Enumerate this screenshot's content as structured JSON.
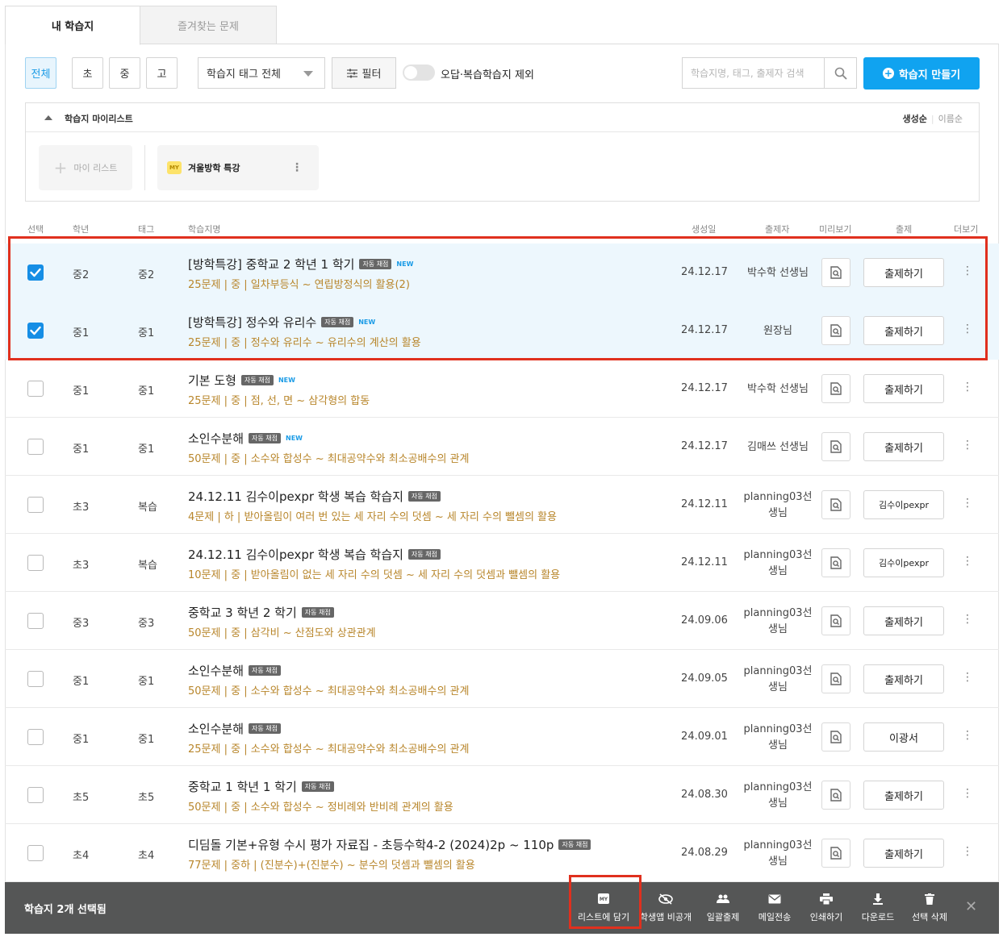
{
  "tabs": {
    "active": "내 학습지",
    "inactive": "즐겨찾는 문제"
  },
  "toolbar": {
    "grades": [
      "전체",
      "초",
      "중",
      "고"
    ],
    "tag_select": "학습지 태그 전체",
    "filter": "필터",
    "toggle_label": "오답·복습학습지 제외",
    "search_placeholder": "학습지명, 태그, 출제자 검색",
    "create": "학습지 만들기"
  },
  "mylist": {
    "title": "학습지 마이리스트",
    "sort_on": "생성순",
    "sort_off": "이름순",
    "add": "마이 리스트",
    "badge": "MY",
    "card": "겨울방학 특강"
  },
  "headers": {
    "select": "선택",
    "grade": "학년",
    "tag": "태그",
    "name": "학습지명",
    "date": "생성일",
    "author": "출제자",
    "preview": "미리보기",
    "assign": "출제",
    "more": "더보기"
  },
  "badges": {
    "auto": "자동 채점",
    "new": "NEW"
  },
  "rows": [
    {
      "checked": true,
      "grade": "중2",
      "tag": "중2",
      "title": "[방학특강] 중학교 2 학년 1 학기",
      "is_new": true,
      "sub": "25문제 | 중 | 일차부등식 ~ 연립방정식의 활용(2)",
      "date": "24.12.17",
      "author": [
        "박수학 선생님"
      ],
      "assign": "출제하기"
    },
    {
      "checked": true,
      "grade": "중1",
      "tag": "중1",
      "title": "[방학특강] 정수와 유리수",
      "is_new": true,
      "sub": "25문제 | 중 | 정수와 유리수 ~ 유리수의 계산의 활용",
      "date": "24.12.17",
      "author": [
        "원장님"
      ],
      "assign": "출제하기"
    },
    {
      "checked": false,
      "grade": "중1",
      "tag": "중1",
      "title": "기본 도형",
      "is_new": true,
      "sub": "25문제 | 중 | 점, 선, 면 ~ 삼각형의 합동",
      "date": "24.12.17",
      "author": [
        "박수학 선생님"
      ],
      "assign": "출제하기"
    },
    {
      "checked": false,
      "grade": "중1",
      "tag": "중1",
      "title": "소인수분해",
      "is_new": true,
      "sub": "50문제 | 중 | 소수와 합성수 ~ 최대공약수와 최소공배수의 관계",
      "date": "24.12.17",
      "author": [
        "김매쓰 선생님"
      ],
      "assign": "출제하기"
    },
    {
      "checked": false,
      "grade": "초3",
      "tag": "복습",
      "title": "24.12.11 김수이pexpr 학생 복습 학습지",
      "is_new": false,
      "sub": "4문제 | 하 | 받아올림이 여러 번 있는 세 자리 수의 덧셈 ~ 세 자리 수의 뺄셈의 활용",
      "date": "24.12.11",
      "author": [
        "planning03선",
        "생님"
      ],
      "assign": "김수이pexpr",
      "assign_small": true
    },
    {
      "checked": false,
      "grade": "초3",
      "tag": "복습",
      "title": "24.12.11 김수이pexpr 학생 복습 학습지",
      "is_new": false,
      "sub": "10문제 | 중 | 받아올림이 없는 세 자리 수의 덧셈 ~ 세 자리 수의 덧셈과 뺄셈의 활용",
      "date": "24.12.11",
      "author": [
        "planning03선",
        "생님"
      ],
      "assign": "김수이pexpr",
      "assign_small": true
    },
    {
      "checked": false,
      "grade": "중3",
      "tag": "중3",
      "title": "중학교 3 학년 2 학기",
      "is_new": false,
      "sub": "50문제 | 중 | 삼각비 ~ 산점도와 상관관계",
      "date": "24.09.06",
      "author": [
        "planning03선",
        "생님"
      ],
      "assign": "출제하기"
    },
    {
      "checked": false,
      "grade": "중1",
      "tag": "중1",
      "title": "소인수분해",
      "is_new": false,
      "sub": "50문제 | 중 | 소수와 합성수 ~ 최대공약수와 최소공배수의 관계",
      "date": "24.09.05",
      "author": [
        "planning03선",
        "생님"
      ],
      "assign": "출제하기"
    },
    {
      "checked": false,
      "grade": "중1",
      "tag": "중1",
      "title": "소인수분해",
      "is_new": false,
      "sub": "25문제 | 중 | 소수와 합성수 ~ 최대공약수와 최소공배수의 관계",
      "date": "24.09.01",
      "author": [
        "planning03선",
        "생님"
      ],
      "assign": "이광서"
    },
    {
      "checked": false,
      "grade": "초5",
      "tag": "초5",
      "title": "중학교 1 학년 1 학기",
      "is_new": false,
      "sub": "50문제 | 중 | 소수와 합성수 ~ 정비례와 반비례 관계의 활용",
      "date": "24.08.30",
      "author": [
        "planning03선",
        "생님"
      ],
      "assign": "출제하기"
    },
    {
      "checked": false,
      "grade": "초4",
      "tag": "초4",
      "title": "디딤돌 기본+유형 수시 평가 자료집 - 초등수학4-2 (2024)2p ~ 110p",
      "is_new": false,
      "sub": "77문제 | 중하 | (진분수)+(진분수) ~ 분수의 덧셈과 뺄셈의 활용",
      "date": "24.08.29",
      "author": [
        "planning03선",
        "생님"
      ],
      "assign": "출제하기"
    }
  ],
  "bottom": {
    "selected_label": "학습지 2개 선택됨",
    "actions": [
      {
        "label": "리스트에 담기",
        "icon": "my-list-icon"
      },
      {
        "label": "학생앱 비공개",
        "icon": "eye-off-icon"
      },
      {
        "label": "일괄출제",
        "icon": "people-icon"
      },
      {
        "label": "메일전송",
        "icon": "mail-icon"
      },
      {
        "label": "인쇄하기",
        "icon": "print-icon"
      },
      {
        "label": "다운로드",
        "icon": "download-icon"
      },
      {
        "label": "선택 삭제",
        "icon": "trash-icon"
      }
    ]
  },
  "colors": {
    "accent": "#10a3f0",
    "selected_row": "#edf7fd",
    "highlight": "#e0301e",
    "subtitle": "#b8862b",
    "bottom_bar": "#555656"
  }
}
